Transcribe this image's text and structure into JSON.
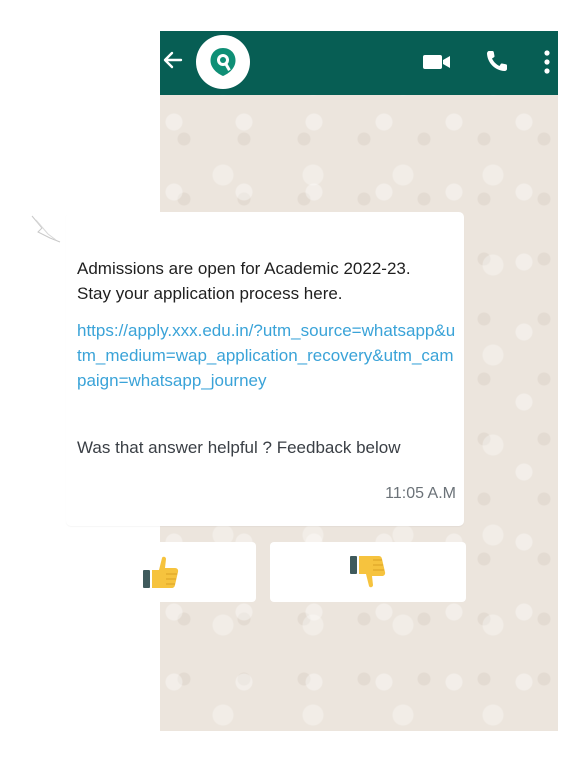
{
  "header": {
    "back_icon": "arrow-left-icon",
    "logo_icon": "location-pin-logo",
    "video_icon": "video-camera-icon",
    "call_icon": "phone-icon",
    "menu_icon": "more-vertical-icon",
    "bar_color": "#075e54",
    "logo_color": "#0f8f76"
  },
  "message": {
    "line1": "Admissions are open for Academic 2022-23.",
    "line2": "Stay your application process here.",
    "link": "https://apply.xxx.edu.in/?utm_source=whatsapp&utm_medium=wap_application_recovery&utm_campaign=whatsapp_journey",
    "feedback": "Was that answer helpful ? Feedback below",
    "time": "11:05 A.M",
    "link_color": "#3aa3d8"
  },
  "buttons": {
    "positive_icon": "thumbs-up-icon",
    "negative_icon": "thumbs-down-icon",
    "thumb_color": "#f6c33e",
    "cuff_color": "#3f5a5c"
  },
  "chat_background": "#ece5dd"
}
